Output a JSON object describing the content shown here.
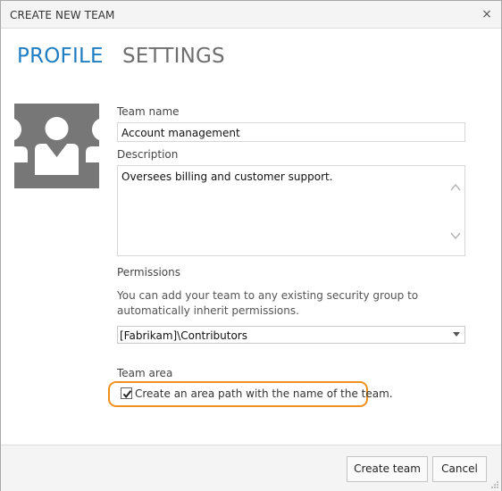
{
  "dialog": {
    "title": "CREATE NEW TEAM",
    "close_glyph": "×"
  },
  "tabs": [
    {
      "label": "PROFILE",
      "active": true
    },
    {
      "label": "SETTINGS",
      "active": false
    }
  ],
  "profile_icon": "team-group-icon",
  "team_name": {
    "label": "Team name",
    "value": "Account management"
  },
  "description": {
    "label": "Description",
    "value": "Oversees billing and customer support."
  },
  "permissions": {
    "label": "Permissions",
    "help": "You can add your team to any existing security group to automatically inherit permissions.",
    "selected": "[Fabrikam]\\Contributors"
  },
  "team_area": {
    "label": "Team area",
    "checkbox_label": "Create an area path with the name of the team.",
    "checked": true
  },
  "buttons": {
    "create": "Create team",
    "cancel": "Cancel"
  },
  "colors": {
    "accent": "#1f7ec2",
    "highlight": "#f0901e",
    "icon_bg": "#777777"
  }
}
